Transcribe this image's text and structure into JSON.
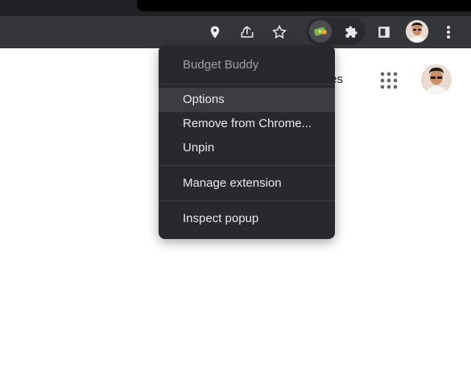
{
  "toolbar": {
    "icons": [
      "location-pin-icon",
      "share-icon",
      "bookmark-star-icon",
      "budget-buddy-extension-icon",
      "puzzle-extensions-icon",
      "side-panel-icon",
      "profile-avatar",
      "more-vert-icon"
    ]
  },
  "page": {
    "partial_link_text": "es"
  },
  "menu": {
    "title": "Budget Buddy",
    "items": [
      {
        "label": "Options"
      },
      {
        "label": "Remove from Chrome..."
      },
      {
        "label": "Unpin"
      },
      {
        "label": "Manage extension"
      },
      {
        "label": "Inspect popup"
      }
    ]
  },
  "colors": {
    "toolbar_bg": "#35363a",
    "menu_bg": "#28292c",
    "menu_text": "#e8eaed",
    "menu_header_text": "#9aa0a6",
    "menu_hover": "#3c3d41"
  }
}
